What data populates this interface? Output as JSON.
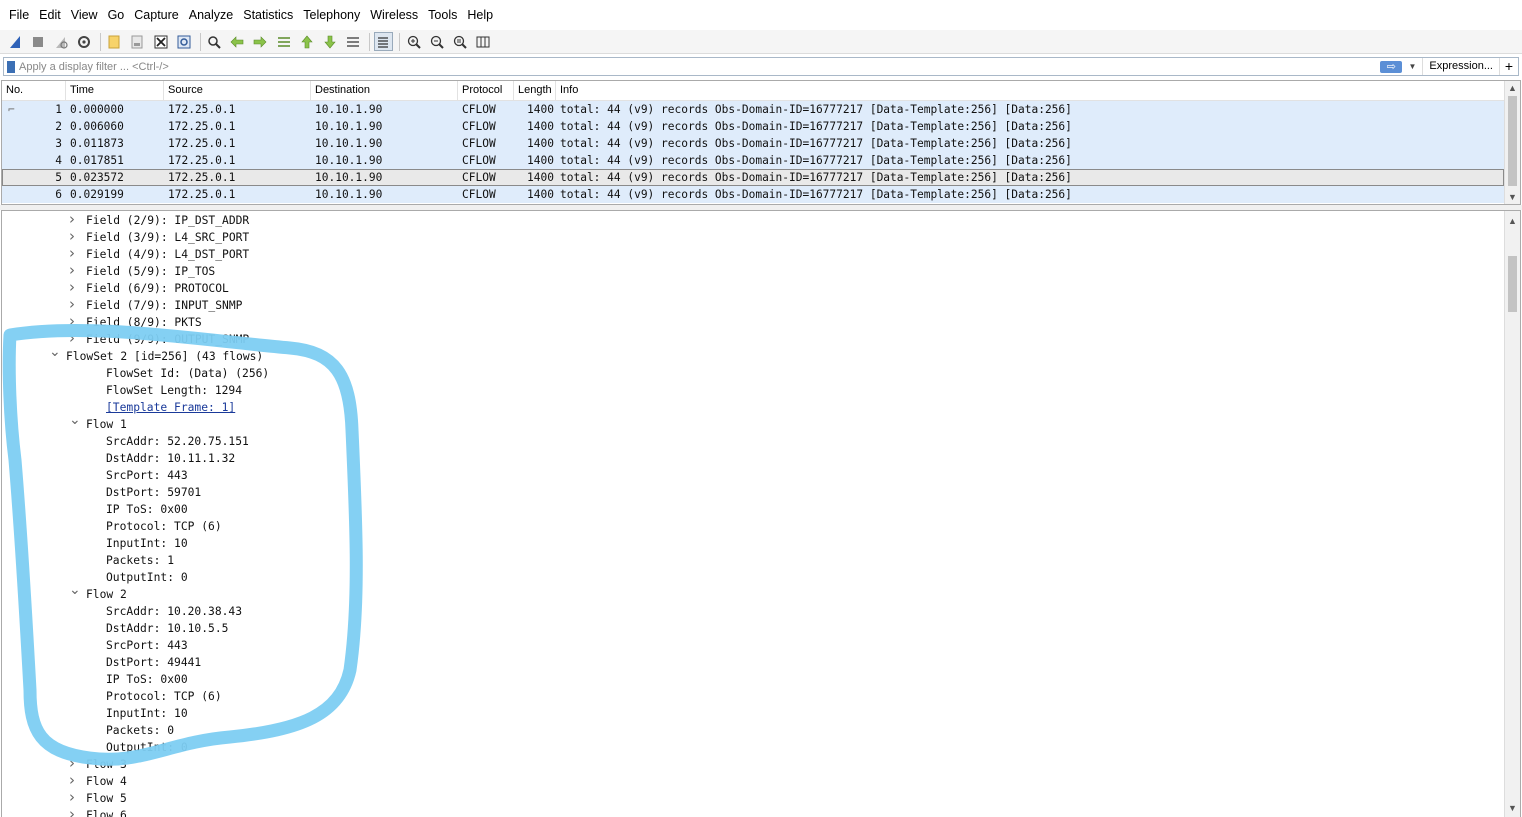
{
  "menu": [
    "File",
    "Edit",
    "View",
    "Go",
    "Capture",
    "Analyze",
    "Statistics",
    "Telephony",
    "Wireless",
    "Tools",
    "Help"
  ],
  "toolbar_icons": [
    "shark-fin-start-icon",
    "stop-icon",
    "restart-icon",
    "options-gear-icon",
    "open-file-icon",
    "save-file-icon",
    "close-file-icon",
    "reload-icon",
    "find-icon",
    "go-back-icon",
    "go-forward-icon",
    "go-to-packet-icon",
    "first-packet-icon",
    "last-packet-icon",
    "auto-scroll-icon",
    "colorize-icon",
    "zoom-in-icon",
    "zoom-out-icon",
    "zoom-normal-icon",
    "resize-columns-icon"
  ],
  "filter": {
    "placeholder": "Apply a display filter ... <Ctrl-/>",
    "expression_label": "Expression...",
    "plus_label": "+"
  },
  "packet_list": {
    "columns": [
      "No.",
      "Time",
      "Source",
      "Destination",
      "Protocol",
      "Length",
      "Info"
    ],
    "rows": [
      {
        "no": "1",
        "time": "0.000000",
        "source": "172.25.0.1",
        "destination": "10.10.1.90",
        "protocol": "CFLOW",
        "length": "1400",
        "info": "total: 44 (v9) records Obs-Domain-ID=16777217 [Data-Template:256] [Data:256]"
      },
      {
        "no": "2",
        "time": "0.006060",
        "source": "172.25.0.1",
        "destination": "10.10.1.90",
        "protocol": "CFLOW",
        "length": "1400",
        "info": "total: 44 (v9) records Obs-Domain-ID=16777217 [Data-Template:256] [Data:256]"
      },
      {
        "no": "3",
        "time": "0.011873",
        "source": "172.25.0.1",
        "destination": "10.10.1.90",
        "protocol": "CFLOW",
        "length": "1400",
        "info": "total: 44 (v9) records Obs-Domain-ID=16777217 [Data-Template:256] [Data:256]"
      },
      {
        "no": "4",
        "time": "0.017851",
        "source": "172.25.0.1",
        "destination": "10.10.1.90",
        "protocol": "CFLOW",
        "length": "1400",
        "info": "total: 44 (v9) records Obs-Domain-ID=16777217 [Data-Template:256] [Data:256]"
      },
      {
        "no": "5",
        "time": "0.023572",
        "source": "172.25.0.1",
        "destination": "10.10.1.90",
        "protocol": "CFLOW",
        "length": "1400",
        "info": "total: 44 (v9) records Obs-Domain-ID=16777217 [Data-Template:256] [Data:256]"
      },
      {
        "no": "6",
        "time": "0.029199",
        "source": "172.25.0.1",
        "destination": "10.10.1.90",
        "protocol": "CFLOW",
        "length": "1400",
        "info": "total: 44 (v9) records Obs-Domain-ID=16777217 [Data-Template:256] [Data:256]"
      }
    ]
  },
  "tree": [
    {
      "text": "Field (2/9): IP_DST_ADDR",
      "caret": "right"
    },
    {
      "text": "Field (3/9): L4_SRC_PORT",
      "caret": "right"
    },
    {
      "text": "Field (4/9): L4_DST_PORT",
      "caret": "right"
    },
    {
      "text": "Field (5/9): IP_TOS",
      "caret": "right"
    },
    {
      "text": "Field (6/9): PROTOCOL",
      "caret": "right"
    },
    {
      "text": "Field (7/9): INPUT_SNMP",
      "caret": "right"
    },
    {
      "text": "Field (8/9): PKTS",
      "caret": "right"
    },
    {
      "text": "Field (9/9): OUTPUT_SNMP",
      "caret": "right"
    },
    {
      "text": "FlowSet 2 [id=256] (43 flows)",
      "caret": "down"
    },
    {
      "text": "FlowSet Id: (Data) (256)",
      "caret": ""
    },
    {
      "text": "FlowSet Length: 1294",
      "caret": ""
    },
    {
      "text": "[Template Frame: 1]",
      "caret": "",
      "link": true
    },
    {
      "text": "Flow 1",
      "caret": "down"
    },
    {
      "text": "SrcAddr: 52.20.75.151",
      "caret": ""
    },
    {
      "text": "DstAddr: 10.11.1.32",
      "caret": ""
    },
    {
      "text": "SrcPort: 443",
      "caret": ""
    },
    {
      "text": "DstPort: 59701",
      "caret": ""
    },
    {
      "text": "IP ToS: 0x00",
      "caret": ""
    },
    {
      "text": "Protocol: TCP (6)",
      "caret": ""
    },
    {
      "text": "InputInt: 10",
      "caret": ""
    },
    {
      "text": "Packets: 1",
      "caret": ""
    },
    {
      "text": "OutputInt: 0",
      "caret": ""
    },
    {
      "text": "Flow 2",
      "caret": "down"
    },
    {
      "text": "SrcAddr: 10.20.38.43",
      "caret": ""
    },
    {
      "text": "DstAddr: 10.10.5.5",
      "caret": ""
    },
    {
      "text": "SrcPort: 443",
      "caret": ""
    },
    {
      "text": "DstPort: 49441",
      "caret": ""
    },
    {
      "text": "IP ToS: 0x00",
      "caret": ""
    },
    {
      "text": "Protocol: TCP (6)",
      "caret": ""
    },
    {
      "text": "InputInt: 10",
      "caret": ""
    },
    {
      "text": "Packets: 0",
      "caret": ""
    },
    {
      "text": "OutputInt: 0",
      "caret": ""
    },
    {
      "text": "Flow 3",
      "caret": "right"
    },
    {
      "text": "Flow 4",
      "caret": "right"
    },
    {
      "text": "Flow 5",
      "caret": "right"
    },
    {
      "text": "Flow 6",
      "caret": "right"
    }
  ],
  "annotation_color": "#7dcdf2",
  "selection_color": "#dfecfb"
}
